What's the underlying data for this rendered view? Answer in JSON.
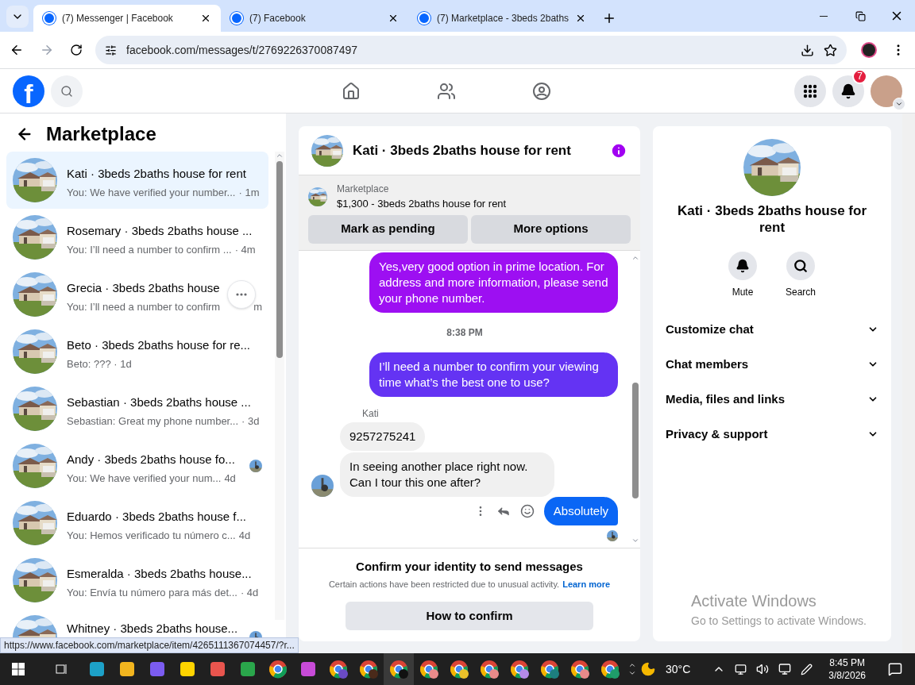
{
  "browser": {
    "tabs": [
      {
        "title": "(7) Messenger | Facebook",
        "selected": true
      },
      {
        "title": "(7) Facebook",
        "selected": false
      },
      {
        "title": "(7) Marketplace - 3beds 2baths",
        "selected": false
      }
    ],
    "url": "facebook.com/messages/t/2769226370087497"
  },
  "header": {
    "logo": "f",
    "notifications": "7"
  },
  "sidebar": {
    "title": "Marketplace",
    "conversations": [
      {
        "title": "Kati · 3beds 2baths house for rent",
        "preview": "You: We have verified your number...",
        "time": "· 1m",
        "selected": true,
        "seen_avatar": false,
        "hovered": false
      },
      {
        "title": "Rosemary · 3beds 2baths house ...",
        "preview": "You: I’ll need a number to confirm ...",
        "time": "· 4m",
        "selected": false,
        "seen_avatar": false,
        "hovered": false
      },
      {
        "title": "Grecia · 3beds 2baths house",
        "preview": "You: I’ll need a number to confirm",
        "time": "m",
        "selected": false,
        "seen_avatar": false,
        "hovered": true
      },
      {
        "title": "Beto · 3beds 2baths house for re...",
        "preview": "Beto: ??? · 1d",
        "selected": false,
        "seen_avatar": false,
        "hovered": false
      },
      {
        "title": "Sebastian · 3beds 2baths house ...",
        "preview": "Sebastian: Great my phone number...",
        "time": "· 3d",
        "selected": false,
        "seen_avatar": false,
        "hovered": false
      },
      {
        "title": "Andy · 3beds 2baths house fo...",
        "preview": "You: We have verified your num...",
        "time": "4d",
        "selected": false,
        "seen_avatar": true,
        "hovered": false
      },
      {
        "title": "Eduardo · 3beds 2baths house f...",
        "preview": "You: Hemos verificado tu número c...",
        "time": "4d",
        "selected": false,
        "seen_avatar": false,
        "hovered": false
      },
      {
        "title": "Esmeralda · 3beds 2baths house...",
        "preview": "You: Envía tu número para más det...",
        "time": "· 4d",
        "selected": false,
        "seen_avatar": false,
        "hovered": false
      },
      {
        "title": "Whitney · 3beds 2baths house...",
        "selected": false,
        "seen_avatar": true,
        "hovered": false
      }
    ]
  },
  "chat": {
    "title": "Kati · 3beds 2baths house for rent",
    "listing": {
      "source": "Marketplace",
      "price_title": "$1,300 - 3beds 2baths house for rent",
      "buttons": [
        "Mark as pending",
        "More options"
      ]
    },
    "messages": [
      {
        "kind": "outgoing",
        "text": "Yes,very good option in prime location. For address and more information, please send your phone number.",
        "color": "#9d0ff2"
      },
      {
        "kind": "timestamp",
        "text": "8:38 PM"
      },
      {
        "kind": "outgoing",
        "text": "I’ll need a number to confirm your viewing time what’s the best one to use?",
        "color": "#6433f3"
      },
      {
        "kind": "sender",
        "text": "Kati"
      },
      {
        "kind": "incoming",
        "text": "9257275241",
        "avatar": false
      },
      {
        "kind": "incoming",
        "text": "In seeing another place right now. Can I tour this one after?",
        "avatar": true
      },
      {
        "kind": "outgoing_actions",
        "text": "Absolutely",
        "color": "#0a66f5"
      }
    ],
    "notice": {
      "title": "Confirm your identity to send messages",
      "body": "Certain actions have been restricted due to unusual activity.",
      "link": "Learn more",
      "button": "How to confirm"
    }
  },
  "details": {
    "name": "Kati · 3beds 2baths house for rent",
    "actions": [
      {
        "kind": "mute",
        "label": "Mute"
      },
      {
        "kind": "search",
        "label": "Search"
      }
    ],
    "sections": [
      "Customize chat",
      "Chat members",
      "Media, files and links",
      "Privacy & support"
    ]
  },
  "activation": {
    "title": "Activate Windows",
    "body": "Go to Settings to activate Windows."
  },
  "status_url": "https://www.facebook.com/marketplace/item/4265111367074457/?r...",
  "taskbar": {
    "apps": [
      {
        "kind": "app",
        "color": "#1da1c8",
        "selected": false
      },
      {
        "kind": "app",
        "color": "#f2b51f",
        "selected": false
      },
      {
        "kind": "app",
        "color": "#7b5cf0",
        "selected": false
      },
      {
        "kind": "app",
        "color": "#ffd400",
        "selected": false
      },
      {
        "kind": "app",
        "color": "#e8554e",
        "selected": false
      },
      {
        "kind": "app",
        "color": "#2aa64b",
        "selected": false
      },
      {
        "kind": "chrome",
        "selected": false
      },
      {
        "kind": "app",
        "color": "#c84bd8",
        "selected": false
      },
      {
        "kind": "chrome",
        "color": "#6a4bc4",
        "selected": false
      },
      {
        "kind": "chrome",
        "color": "#4a2a1a",
        "selected": false
      },
      {
        "kind": "chrome",
        "color": "#111111",
        "selected": true
      },
      {
        "kind": "chrome",
        "color": "#e98a8a",
        "selected": false
      },
      {
        "kind": "chrome",
        "color": "#e9c02a",
        "selected": false
      },
      {
        "kind": "chrome",
        "color": "#e98a8a",
        "selected": false
      },
      {
        "kind": "chrome",
        "color": "#b58ae8",
        "selected": false
      },
      {
        "kind": "chrome",
        "color": "#1d7f7f",
        "selected": false
      },
      {
        "kind": "chrome",
        "color": "#e98a8a",
        "selected": false
      },
      {
        "kind": "chrome",
        "color": "#1f9d6a",
        "selected": false
      }
    ],
    "temperature": "30°C",
    "time": "8:45 PM",
    "date": "3/8/2026"
  }
}
